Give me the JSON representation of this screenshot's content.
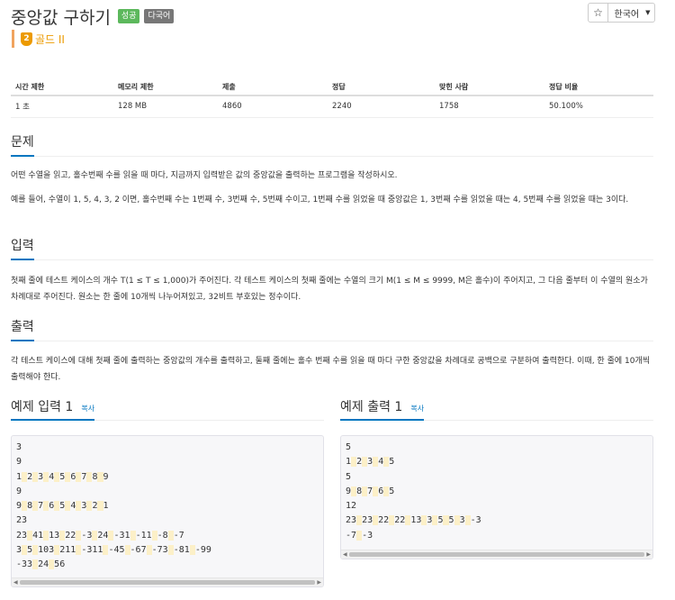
{
  "problem": {
    "title": "중앙값 구하기",
    "badges": [
      "성공",
      "다국어"
    ],
    "tier": {
      "icon_text": "2",
      "label": "골드 II",
      "color": "#ec9a00"
    }
  },
  "toolbar": {
    "star_icon": "star-icon",
    "star_glyph": "☆",
    "language": "한국어",
    "caret": "▼"
  },
  "info_table": {
    "headers": [
      "시간 제한",
      "메모리 제한",
      "제출",
      "정답",
      "맞힌 사람",
      "정답 비율"
    ],
    "values": [
      "1 초",
      "128 MB",
      "4860",
      "2240",
      "1758",
      "50.100%"
    ]
  },
  "sections": {
    "problem": {
      "heading": "문제",
      "paragraphs": [
        "어떤 수열을 읽고, 홀수번째 수를 읽을 때 마다, 지금까지 입력받은 값의 중앙값을 출력하는 프로그램을 작성하시오.",
        "예를 들어, 수열이 1, 5, 4, 3, 2 이면, 홀수번째 수는 1번째 수, 3번째 수, 5번째 수이고, 1번째 수를 읽었을 때 중앙값은 1, 3번째 수를 읽었을 때는 4, 5번째 수를 읽었을 때는 3이다."
      ]
    },
    "input": {
      "heading": "입력",
      "paragraphs": [
        "첫째 줄에 테스트 케이스의 개수 T(1 ≤ T ≤ 1,000)가 주어진다. 각 테스트 케이스의 첫째 줄에는 수열의 크기 M(1 ≤ M ≤ 9999, M은 홀수)이 주어지고, 그 다음 줄부터 이 수열의 원소가 차례대로 주어진다. 원소는 한 줄에 10개씩 나누어져있고, 32비트 부호있는 정수이다."
      ]
    },
    "output": {
      "heading": "출력",
      "paragraphs": [
        "각 테스트 케이스에 대해 첫째 줄에 출력하는 중앙값의 개수를 출력하고, 둘째 줄에는 홀수 번째 수를 읽을 때 마다 구한 중앙값을 차례대로 공백으로 구분하여 출력한다. 이때, 한 줄에 10개씩 출력해야 한다."
      ]
    }
  },
  "samples": {
    "input": {
      "title": "예제 입력 1",
      "copy_label": "복사",
      "lines": [
        [
          "3"
        ],
        [
          "9"
        ],
        [
          "1",
          "2",
          "3",
          "4",
          "5",
          "6",
          "7",
          "8",
          "9"
        ],
        [
          "9"
        ],
        [
          "9",
          "8",
          "7",
          "6",
          "5",
          "4",
          "3",
          "2",
          "1"
        ],
        [
          "23"
        ],
        [
          "23",
          "41",
          "13",
          "22",
          "-3",
          "24",
          "-31",
          "-11",
          "-8",
          "-7"
        ],
        [
          "3",
          "5",
          "103",
          "211",
          "-311",
          "-45",
          "-67",
          "-73",
          "-81",
          "-99"
        ],
        [
          "-33",
          "24",
          "56"
        ]
      ]
    },
    "output": {
      "title": "예제 출력 1",
      "copy_label": "복사",
      "lines": [
        [
          "5"
        ],
        [
          "1",
          "2",
          "3",
          "4",
          "5"
        ],
        [
          "5"
        ],
        [
          "9",
          "8",
          "7",
          "6",
          "5"
        ],
        [
          "12"
        ],
        [
          "23",
          "23",
          "22",
          "22",
          "13",
          "3",
          "5",
          "5",
          "3",
          "-3"
        ],
        [
          "-7",
          "-3"
        ]
      ]
    }
  },
  "colors": {
    "accent": "#0076c0",
    "success": "#5cb85c",
    "badge_gray": "#777777",
    "tier": "#ec9a00"
  }
}
